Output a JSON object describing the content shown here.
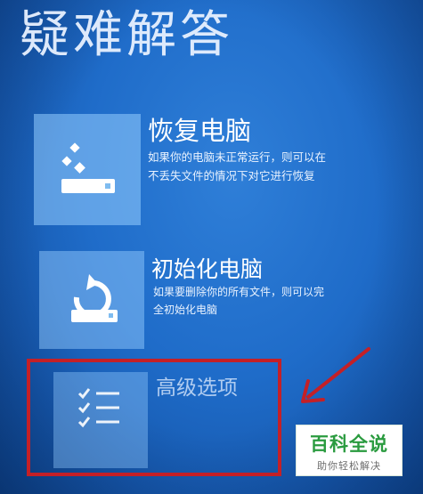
{
  "page": {
    "title": "疑难解答"
  },
  "options": [
    {
      "title": "恢复电脑",
      "description_lines": [
        "如果你的电脑未正常运行，则可以在",
        "不丢失文件的情况下对它进行恢复"
      ],
      "icon": "refresh-pc-icon"
    },
    {
      "title": "初始化电脑",
      "description_lines": [
        "如果要删除你的所有文件，则可以完",
        "全初始化电脑"
      ],
      "icon": "reset-pc-icon"
    },
    {
      "title": "高级选项",
      "description_lines": [],
      "icon": "checklist-icon"
    }
  ],
  "annotation": {
    "color": "#c42027",
    "arrow": "red-arrow-icon",
    "highlight": "highlight-box"
  },
  "watermark": {
    "title": "百科全说",
    "subtitle": "助你轻松解决"
  },
  "colors": {
    "background": "#1f6cc9",
    "tile": "#96cdff",
    "text": "#ffffff",
    "watermark_green": "#2a9b3f"
  }
}
